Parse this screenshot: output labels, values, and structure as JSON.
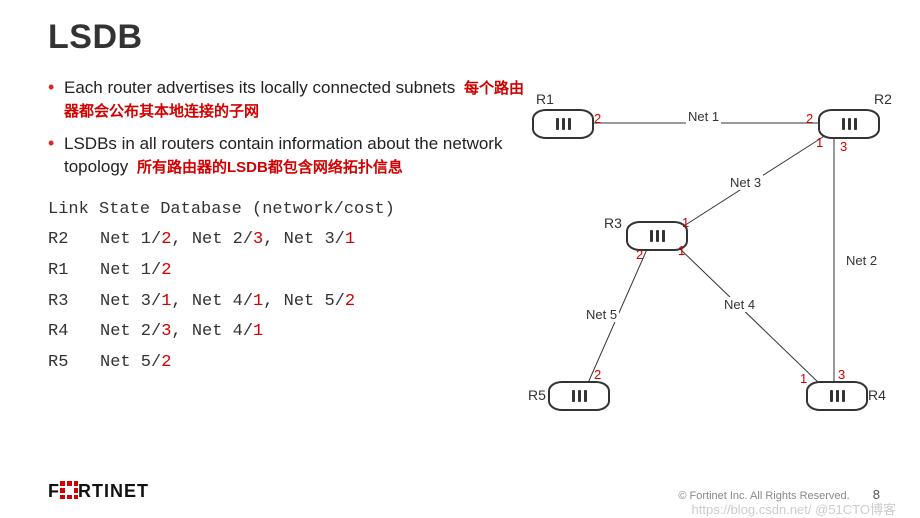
{
  "title": "LSDB",
  "bullets": [
    {
      "en": "Each router advertises its locally connected subnets",
      "zh": "每个路由器都会公布其本地连接的子网"
    },
    {
      "en": "LSDBs in all routers contain information about the network topology",
      "zh": "所有路由器的LSDB都包含网络拓扑信息"
    }
  ],
  "lsdb_header": "Link State Database (network/cost)",
  "lsdb_rows": [
    {
      "r": "R2",
      "entries": [
        {
          "net": "Net 1",
          "cost": "2"
        },
        {
          "net": "Net 2",
          "cost": "3"
        },
        {
          "net": "Net 3",
          "cost": "1"
        }
      ]
    },
    {
      "r": "R1",
      "entries": [
        {
          "net": "Net 1",
          "cost": "2"
        }
      ]
    },
    {
      "r": "R3",
      "entries": [
        {
          "net": "Net 3",
          "cost": "1"
        },
        {
          "net": "Net 4",
          "cost": "1"
        },
        {
          "net": "Net 5",
          "cost": "2"
        }
      ]
    },
    {
      "r": "R4",
      "entries": [
        {
          "net": "Net 2",
          "cost": "3"
        },
        {
          "net": "Net 4",
          "cost": "1"
        }
      ]
    },
    {
      "r": "R5",
      "entries": [
        {
          "net": "Net 5",
          "cost": "2"
        }
      ]
    }
  ],
  "diagram": {
    "routers": {
      "R1": "R1",
      "R2": "R2",
      "R3": "R3",
      "R4": "R4",
      "R5": "R5"
    },
    "nets": {
      "n1": "Net 1",
      "n2": "Net 2",
      "n3": "Net 3",
      "n4": "Net 4",
      "n5": "Net 5"
    },
    "ports": {
      "r1_n1": "2",
      "r2_n1": "2",
      "r2_n3": "1",
      "r2_n2": "3",
      "r3_n3": "1",
      "r3_n4": "1",
      "r3_n5": "2",
      "r4_n4": "1",
      "r4_n2": "3",
      "r5_n5": "2"
    }
  },
  "footer": {
    "brand": "F",
    "brand_rest": "RTINET",
    "copyright": "© Fortinet Inc. All Rights Reserved.",
    "page": "8"
  },
  "watermark": "https://blog.csdn.net/  @51CTO博客"
}
